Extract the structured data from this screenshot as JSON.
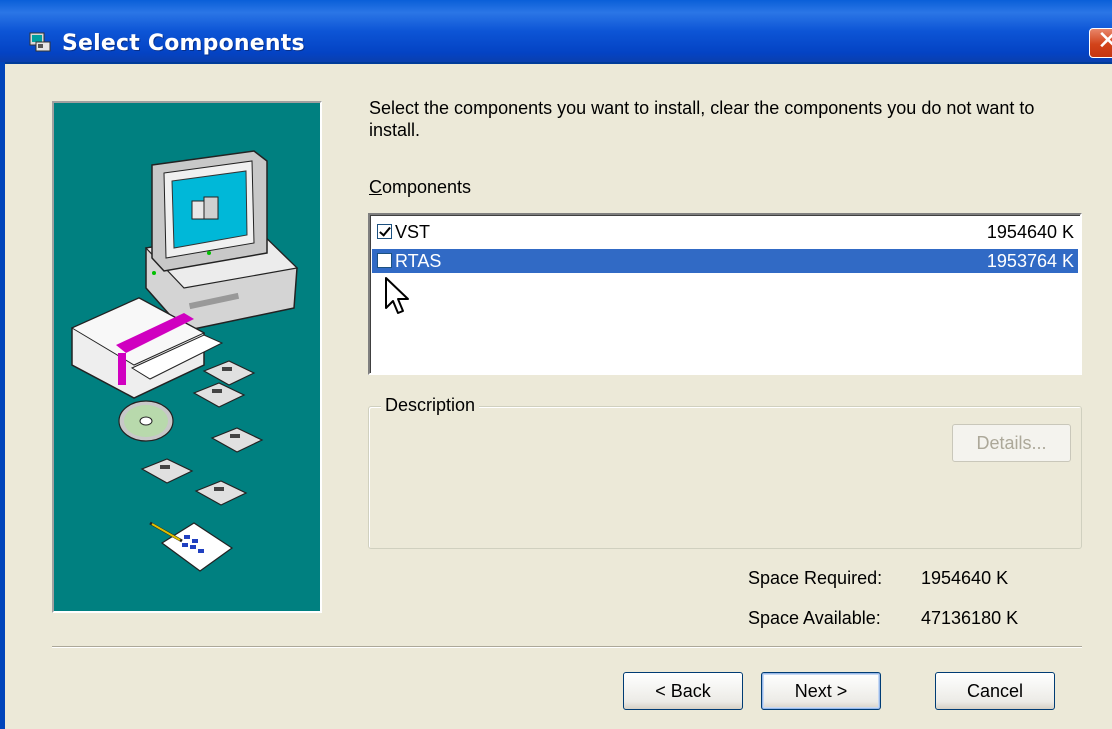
{
  "window": {
    "title": "Select Components",
    "close_icon": "close-icon",
    "app_icon": "setup-icon"
  },
  "intro_text": "Select the components you want to install, clear the components you do not want to install.",
  "components": {
    "label": "Components",
    "items": [
      {
        "name": "VST",
        "size": "1954640 K",
        "checked": true,
        "selected": false
      },
      {
        "name": "RTAS",
        "size": "1953764 K",
        "checked": false,
        "selected": true
      }
    ]
  },
  "description": {
    "legend": "Description",
    "details_button": "Details..."
  },
  "space": {
    "required_label": "Space Required:",
    "required_value": "1954640 K",
    "available_label": "Space Available:",
    "available_value": "47136180 K"
  },
  "buttons": {
    "back": "< Back",
    "next": "Next >",
    "cancel": "Cancel"
  },
  "colors": {
    "titlebar": "#0a5fd8",
    "selection": "#316ac5",
    "art_background": "#008080",
    "dialog_background": "#ece9d8"
  }
}
